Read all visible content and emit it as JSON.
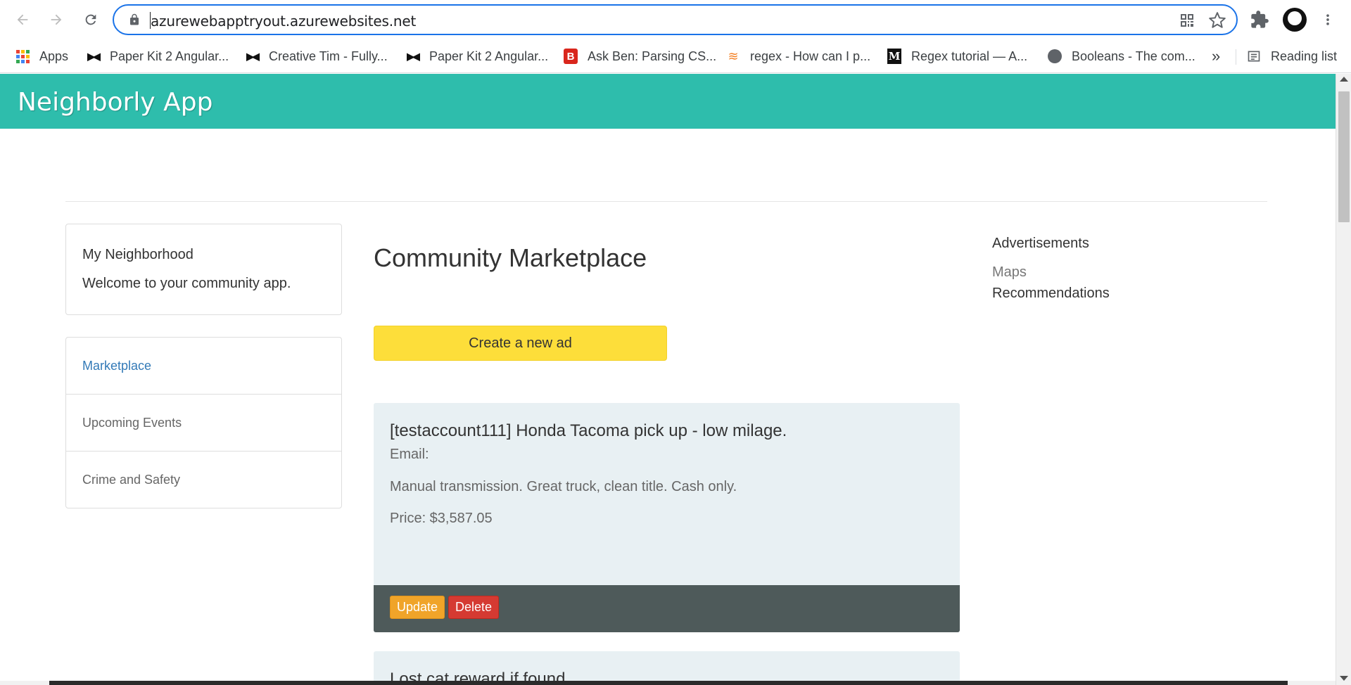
{
  "browser": {
    "url": "azurewebapptryout.azurewebsites.net",
    "bookmarks": [
      {
        "label": "Apps",
        "icon": "apps-grid-icon"
      },
      {
        "label": "Paper Kit 2 Angular...",
        "icon": "bowtie-icon"
      },
      {
        "label": "Creative Tim - Fully...",
        "icon": "bowtie-icon"
      },
      {
        "label": "Paper Kit 2 Angular...",
        "icon": "bowtie-icon"
      },
      {
        "label": "Ask Ben: Parsing CS...",
        "icon": "b-logo-icon"
      },
      {
        "label": "regex - How can I p...",
        "icon": "stackoverflow-icon"
      },
      {
        "label": "Regex tutorial — A...",
        "icon": "medium-icon"
      },
      {
        "label": "Booleans - The com...",
        "icon": "globe-icon"
      }
    ],
    "more_label": "»",
    "reading_list": "Reading list"
  },
  "app": {
    "title": "Neighborly App",
    "header_color": "#2ebdac"
  },
  "panel": {
    "title": "My Neighborhood",
    "text": "Welcome to your community app."
  },
  "nav": {
    "items": [
      {
        "label": "Marketplace",
        "active": true
      },
      {
        "label": "Upcoming Events",
        "active": false
      },
      {
        "label": "Crime and Safety",
        "active": false
      }
    ]
  },
  "main": {
    "title": "Community Marketplace",
    "create_button": "Create a new ad",
    "ads": [
      {
        "title": "[testaccount111] Honda Tacoma pick up - low milage.",
        "email": "Email:",
        "description": "Manual transmission. Great truck, clean title. Cash only.",
        "price": "Price: $3,587.05",
        "update_label": "Update",
        "delete_label": "Delete"
      },
      {
        "title": "Lost cat reward if found"
      }
    ]
  },
  "sidebar_right": {
    "heading": "Advertisements",
    "maps": "Maps",
    "recommendations": "Recommendations"
  }
}
